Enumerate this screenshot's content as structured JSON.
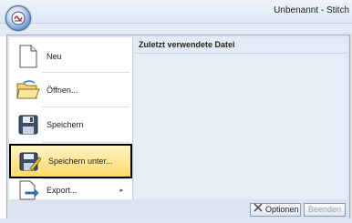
{
  "window": {
    "title": "Unbenannt - Stitch",
    "icon": "app-logo-icon"
  },
  "menu": {
    "items": [
      {
        "label": "Neu",
        "icon": "new-document-icon"
      },
      {
        "label": "Öffnen...",
        "icon": "open-folder-icon"
      },
      {
        "label": "Speichern",
        "icon": "save-icon"
      },
      {
        "label": "Speichern unter...",
        "icon": "save-as-icon",
        "selected": true
      },
      {
        "label": "Export...",
        "icon": "export-icon",
        "submenu_arrow": "▸"
      }
    ],
    "recent_header": "Zuletzt verwendete Datei",
    "options_label": "Optionen",
    "exit_label": "Beenden"
  }
}
